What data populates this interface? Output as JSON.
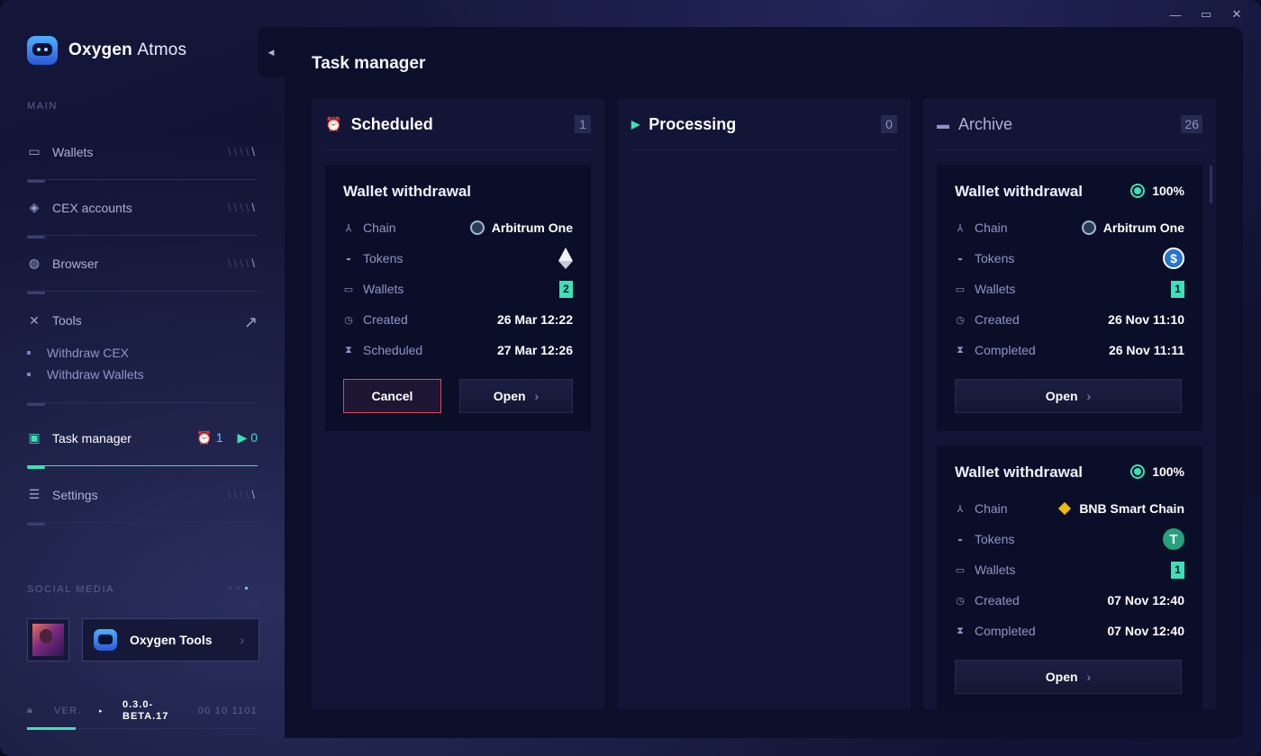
{
  "app": {
    "brand_bold": "Oxygen",
    "brand_light": "Atmos"
  },
  "sidebar": {
    "main_label": "MAIN",
    "items": [
      {
        "label": "Wallets",
        "icon": "wallet-icon",
        "arrow": "\\"
      },
      {
        "label": "CEX accounts",
        "icon": "layers-icon",
        "arrow": "\\"
      },
      {
        "label": "Browser",
        "icon": "globe-icon",
        "arrow": "\\"
      },
      {
        "label": "Tools",
        "icon": "tools-icon",
        "arrow": "↗"
      },
      {
        "label": "Task manager",
        "icon": "task-icon"
      },
      {
        "label": "Settings",
        "icon": "sliders-icon",
        "arrow": "\\"
      }
    ],
    "tools_sub": [
      "Withdraw CEX",
      "Withdraw Wallets"
    ],
    "task_counts": {
      "scheduled": "1",
      "processing": "0"
    },
    "social_label": "SOCIAL MEDIA",
    "social_link": "Oxygen Tools",
    "version_label": "VER.",
    "version": "0.3.0-BETA.17",
    "version_code": "00 10 1101"
  },
  "main": {
    "title": "Task manager",
    "columns": [
      {
        "title": "Scheduled",
        "count": "1",
        "icon": "alarm-icon"
      },
      {
        "title": "Processing",
        "count": "0",
        "icon": "play-icon"
      },
      {
        "title": "Archive",
        "count": "26",
        "icon": "folder-icon"
      }
    ]
  },
  "labels": {
    "chain": "Chain",
    "tokens": "Tokens",
    "wallets": "Wallets",
    "created": "Created",
    "scheduled": "Scheduled",
    "completed": "Completed",
    "cancel": "Cancel",
    "open": "Open"
  },
  "scheduled_card": {
    "title": "Wallet withdrawal",
    "chain": "Arbitrum One",
    "token": "ETH",
    "wallets": "2",
    "created": "26 Mar 12:22",
    "scheduled": "27 Mar 12:26"
  },
  "archive_cards": [
    {
      "title": "Wallet withdrawal",
      "progress": "100%",
      "chain": "Arbitrum One",
      "token": "USDC",
      "wallets": "1",
      "created": "26 Nov 11:10",
      "completed": "26 Nov 11:11"
    },
    {
      "title": "Wallet withdrawal",
      "progress": "100%",
      "chain": "BNB Smart Chain",
      "token": "USDT",
      "wallets": "1",
      "created": "07 Nov 12:40",
      "completed": "07 Nov 12:40"
    }
  ],
  "colors": {
    "accent": "#3ce2b6",
    "blue": "#62c4ff",
    "cancel": "#e0485a"
  }
}
